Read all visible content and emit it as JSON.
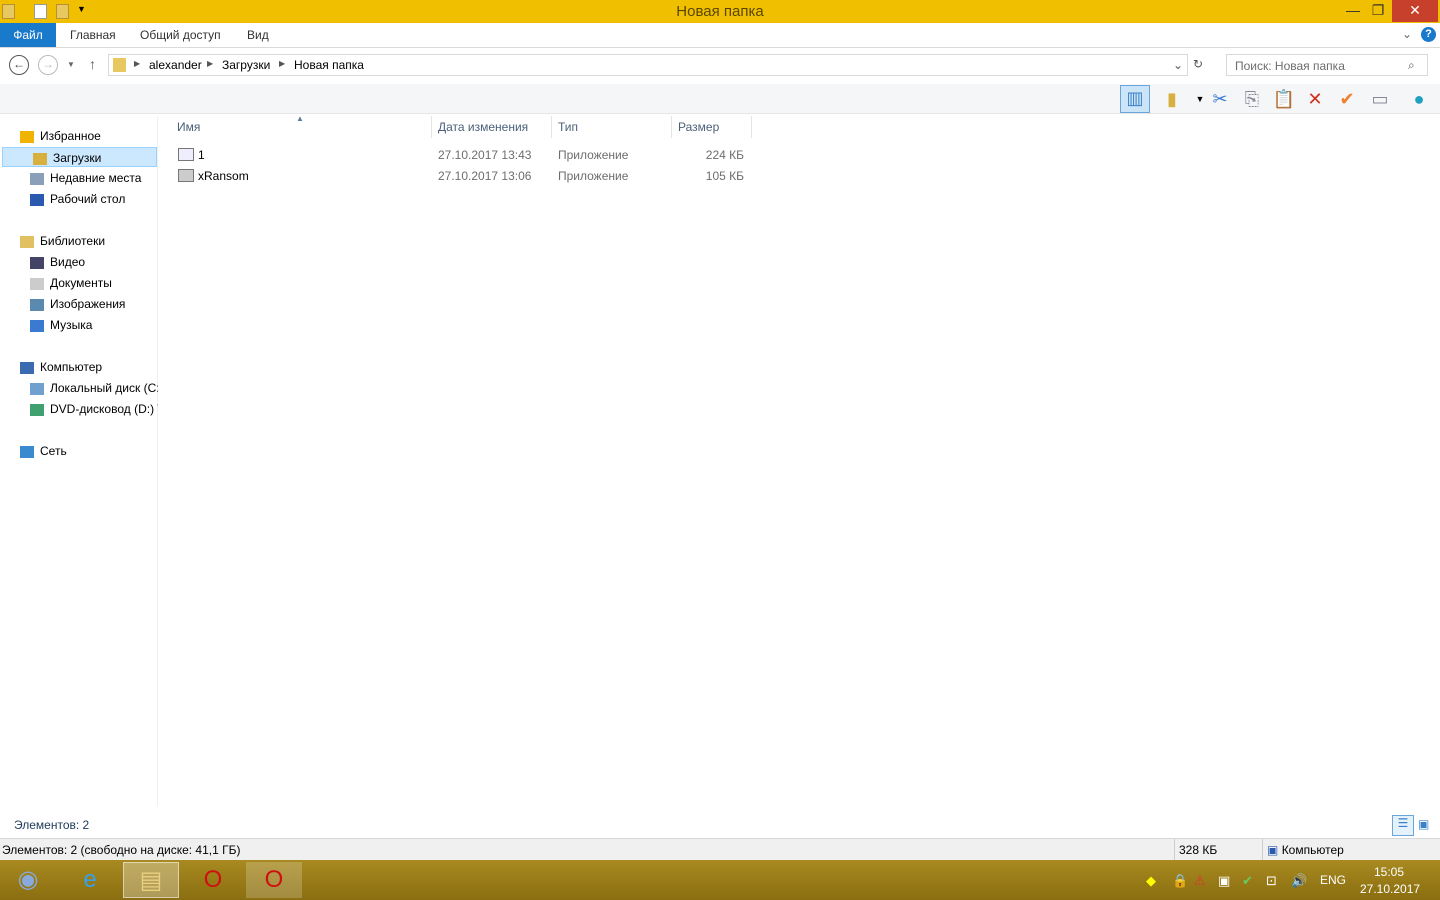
{
  "window": {
    "title": "Новая папка",
    "minimize": "—",
    "restore": "❐",
    "close": "✕"
  },
  "ribbon": {
    "tabs": [
      "Файл",
      "Главная",
      "Общий доступ",
      "Вид"
    ],
    "help": "?"
  },
  "address": {
    "crumbs": [
      "alexander",
      "Загрузки",
      "Новая папка"
    ],
    "search_placeholder": "Поиск: Новая папка"
  },
  "nav": {
    "items": [
      {
        "label": "Избранное",
        "level": 0,
        "color": "#f0b400"
      },
      {
        "label": "Загрузки",
        "level": 1,
        "selected": true,
        "color": "#d8b040"
      },
      {
        "label": "Недавние места",
        "level": 1,
        "color": "#8aa0b8"
      },
      {
        "label": "Рабочий стол",
        "level": 1,
        "color": "#2a5ab0"
      },
      {
        "label": "Библиотеки",
        "level": 0,
        "color": "#e0c060"
      },
      {
        "label": "Видео",
        "level": 1,
        "color": "#446"
      },
      {
        "label": "Документы",
        "level": 1,
        "color": "#ccc"
      },
      {
        "label": "Изображения",
        "level": 1,
        "color": "#5a8ab0"
      },
      {
        "label": "Музыка",
        "level": 1,
        "color": "#3a7ad0"
      },
      {
        "label": "Компьютер",
        "level": 0,
        "color": "#3a6ab0"
      },
      {
        "label": "Локальный диск (C:)",
        "level": 1,
        "color": "#70a0d0"
      },
      {
        "label": "DVD-дисковод (D:) V",
        "level": 1,
        "color": "#40a070"
      },
      {
        "label": "Сеть",
        "level": 0,
        "color": "#3a8ad0"
      }
    ]
  },
  "columns": [
    "Имя",
    "Дата изменения",
    "Тип",
    "Размер"
  ],
  "files": [
    {
      "name": "1",
      "date": "27.10.2017 13:43",
      "type": "Приложение",
      "size": "224 КБ"
    },
    {
      "name": "xRansom",
      "date": "27.10.2017 13:06",
      "type": "Приложение",
      "size": "105 КБ"
    }
  ],
  "status": {
    "items": "Элементов: 2",
    "bottom": "Элементов: 2 (свободно на диске: 41,1 ГБ)",
    "size": "328 КБ",
    "location": "Компьютер"
  },
  "tray": {
    "lang": "ENG",
    "time": "15:05",
    "date": "27.10.2017"
  }
}
